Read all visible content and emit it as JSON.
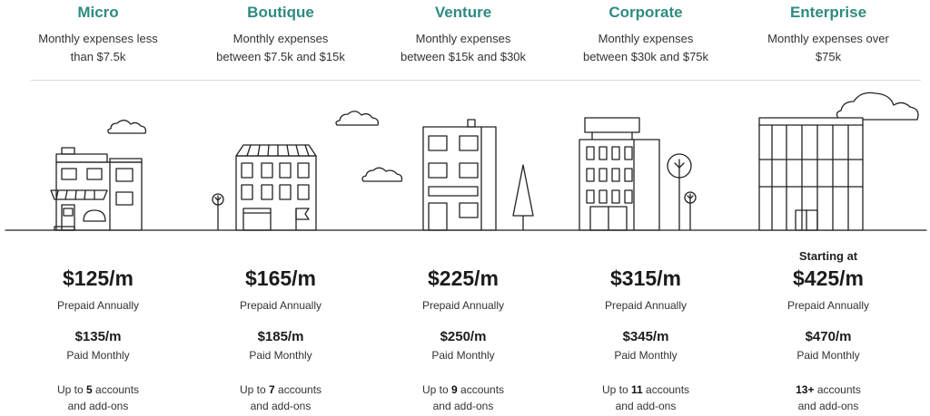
{
  "plans": [
    {
      "name": "Micro",
      "desc_line1": "Monthly expenses less",
      "desc_line2": "than $7.5k",
      "starting": "",
      "annual_price": "$125/m",
      "annual_label": "Prepaid Annually",
      "monthly_price": "$135/m",
      "monthly_label": "Paid Monthly",
      "accounts_prefix": "Up to",
      "accounts_count": "5",
      "accounts_suffix": "accounts",
      "accounts_line2": "and add-ons"
    },
    {
      "name": "Boutique",
      "desc_line1": "Monthly expenses",
      "desc_line2": "between $7.5k and $15k",
      "starting": "",
      "annual_price": "$165/m",
      "annual_label": "Prepaid Annually",
      "monthly_price": "$185/m",
      "monthly_label": "Paid Monthly",
      "accounts_prefix": "Up to",
      "accounts_count": "7",
      "accounts_suffix": "accounts",
      "accounts_line2": "and add-ons"
    },
    {
      "name": "Venture",
      "desc_line1": "Monthly expenses",
      "desc_line2": "between $15k and $30k",
      "starting": "",
      "annual_price": "$225/m",
      "annual_label": "Prepaid Annually",
      "monthly_price": "$250/m",
      "monthly_label": "Paid Monthly",
      "accounts_prefix": "Up to",
      "accounts_count": "9",
      "accounts_suffix": "accounts",
      "accounts_line2": "and add-ons"
    },
    {
      "name": "Corporate",
      "desc_line1": "Monthly expenses",
      "desc_line2": "between $30k and $75k",
      "starting": "",
      "annual_price": "$315/m",
      "annual_label": "Prepaid Annually",
      "monthly_price": "$345/m",
      "monthly_label": "Paid Monthly",
      "accounts_prefix": "Up to",
      "accounts_count": "11",
      "accounts_suffix": "accounts",
      "accounts_line2": "and add-ons"
    },
    {
      "name": "Enterprise",
      "desc_line1": "Monthly expenses over",
      "desc_line2": "$75k",
      "starting": "Starting at",
      "annual_price": "$425/m",
      "annual_label": "Prepaid Annually",
      "monthly_price": "$470/m",
      "monthly_label": "Paid Monthly",
      "accounts_prefix": "",
      "accounts_count": "13+",
      "accounts_suffix": "accounts",
      "accounts_line2": "and add-ons"
    }
  ],
  "colors": {
    "accent": "#2e8b81",
    "line": "#222222",
    "divider": "#d9d9d9"
  },
  "icons": [
    "cloud-icon",
    "tree-icon",
    "flag-icon",
    "micro-building-icon",
    "boutique-building-icon",
    "venture-building-icon",
    "corporate-building-icon",
    "enterprise-building-icon"
  ]
}
